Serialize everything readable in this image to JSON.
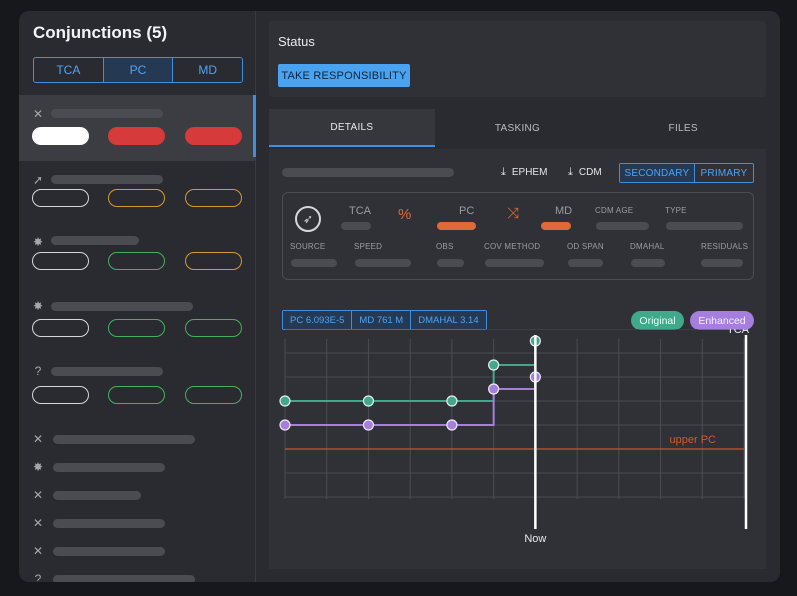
{
  "sidebar": {
    "title": "Conjunctions (5)",
    "segments": [
      "TCA",
      "PC",
      "MD"
    ],
    "active_segment": "PC",
    "items": [
      {
        "icon": "satellite-icon",
        "pills": [
          "white-filled",
          "red-filled",
          "red-filled"
        ],
        "selected": true
      },
      {
        "icon": "rocket-icon",
        "pills": [
          "white",
          "orange",
          "orange"
        ]
      },
      {
        "icon": "debris-icon",
        "pills": [
          "white",
          "green",
          "orange"
        ]
      },
      {
        "icon": "debris-icon",
        "pills": [
          "white",
          "green",
          "green"
        ]
      },
      {
        "icon": "unknown-icon",
        "pills": [
          "white",
          "green",
          "green"
        ]
      }
    ],
    "compact_items": [
      "satellite-icon",
      "debris-icon",
      "satellite-icon",
      "satellite-icon",
      "satellite-icon",
      "unknown-icon"
    ]
  },
  "status": {
    "title": "Status",
    "take_responsibility": "TAKE RESPONSIBILITY"
  },
  "tabs": [
    {
      "label": "DETAILS",
      "active": true
    },
    {
      "label": "TASKING",
      "active": false
    },
    {
      "label": "FILES",
      "active": false
    }
  ],
  "details": {
    "ephem_label": "EPHEM",
    "cdm_label": "CDM",
    "object_toggle": [
      "SECONDARY",
      "PRIMARY"
    ],
    "active_object": "SECONDARY",
    "info": {
      "tca": "TCA",
      "pc": "PC",
      "md": "MD",
      "cdm_age": "CDM AGE",
      "type": "TYPE",
      "source": "SOURCE",
      "speed": "SPEED",
      "obs": "OBS",
      "cov_method": "COV METHOD",
      "od_span": "OD SPAN",
      "dmahal": "DMAHAL",
      "residuals": "RESIDUALS"
    },
    "chips": [
      "PC 6.093E-5",
      "MD 761 M",
      "DMAHAL 3.14"
    ],
    "legend": [
      "Original",
      "Enhanced"
    ]
  },
  "chart_data": {
    "type": "line",
    "series": [
      {
        "name": "Original",
        "color": "#3fa98a",
        "points": [
          [
            0,
            4
          ],
          [
            2,
            4
          ],
          [
            4,
            4
          ],
          [
            5,
            5.5
          ],
          [
            6,
            6.5
          ]
        ]
      },
      {
        "name": "Enhanced",
        "color": "#a67ee0",
        "points": [
          [
            0,
            3
          ],
          [
            2,
            3
          ],
          [
            4,
            3
          ],
          [
            5,
            4.5
          ],
          [
            6,
            5
          ]
        ]
      }
    ],
    "annotations": {
      "threshold_label": "upper PC",
      "threshold_value": 2,
      "now_label": "Now",
      "now_x": 6,
      "tca_label": "TCA",
      "tca_x": 11
    },
    "xlim": [
      0,
      11
    ],
    "ylim": [
      0,
      7
    ],
    "grid": true
  }
}
